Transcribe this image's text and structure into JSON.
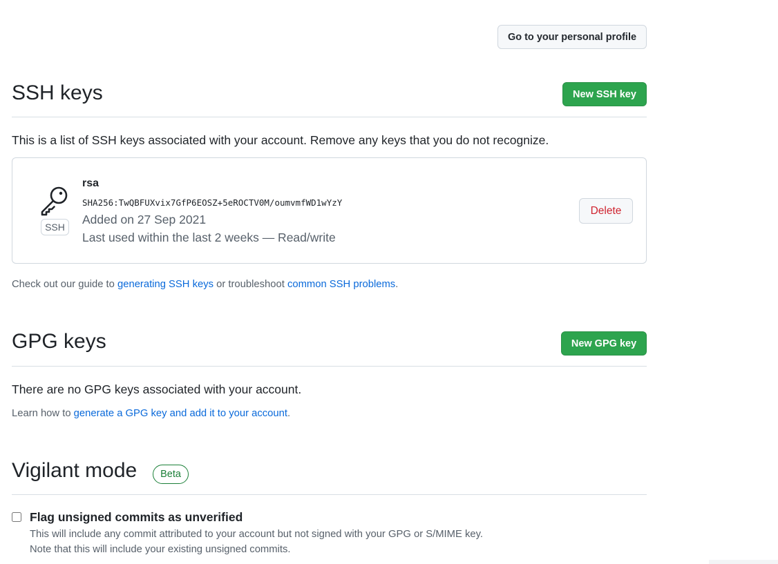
{
  "header": {
    "profile_button": "Go to your personal profile"
  },
  "ssh": {
    "title": "SSH keys",
    "new_button": "New SSH key",
    "intro": "This is a list of SSH keys associated with your account. Remove any keys that you do not recognize.",
    "keys": [
      {
        "name": "rsa",
        "badge": "SSH",
        "icon": "key-icon",
        "fingerprint": "SHA256:TwQBFUXvix7GfP6EOSZ+5eROCTV0M/oumvmfWD1wYzY",
        "added": "Added on 27 Sep 2021",
        "last_used": "Last used within the last 2 weeks — Read/write",
        "delete_label": "Delete"
      }
    ],
    "guide": {
      "prefix": "Check out our guide to ",
      "link1": "generating SSH keys",
      "middle": " or troubleshoot ",
      "link2": "common SSH problems",
      "suffix": "."
    }
  },
  "gpg": {
    "title": "GPG keys",
    "new_button": "New GPG key",
    "empty": "There are no GPG keys associated with your account.",
    "learn": {
      "prefix": "Learn how to ",
      "link": "generate a GPG key and add it to your account",
      "suffix": "."
    }
  },
  "vigilant": {
    "title": "Vigilant mode",
    "badge": "Beta",
    "checkbox_label": "Flag unsigned commits as unverified",
    "checked": false,
    "note_line1": "This will include any commit attributed to your account but not signed with your GPG or S/MIME key.",
    "note_line2": "Note that this will include your existing unsigned commits."
  },
  "colors": {
    "primary_green": "#2da44e",
    "link_blue": "#0969da",
    "danger_red": "#cf222e",
    "beta_green": "#1a7f37"
  }
}
